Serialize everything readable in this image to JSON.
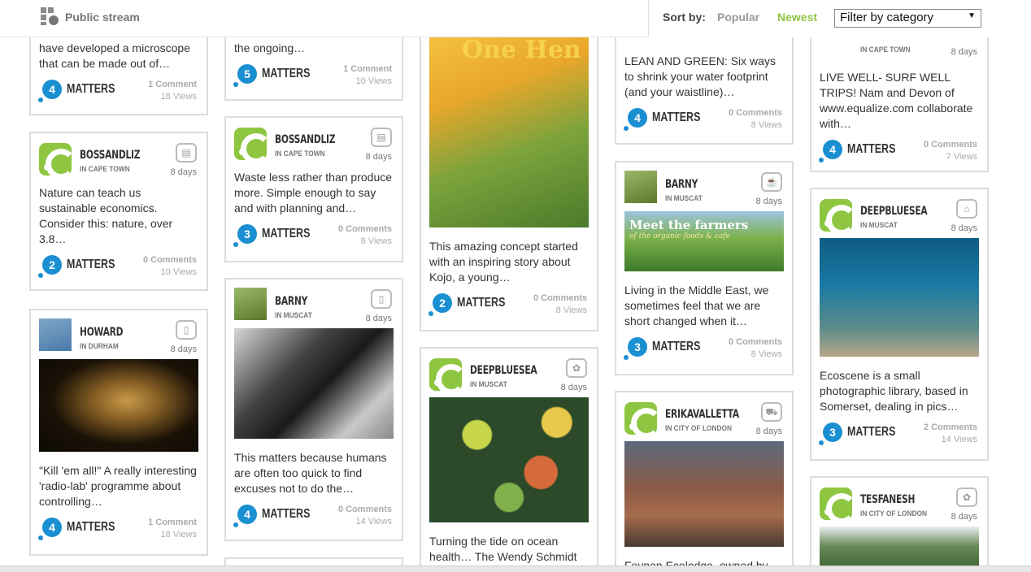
{
  "header": {
    "title": "Public stream"
  },
  "sort": {
    "label": "Sort by:",
    "popular": "Popular",
    "newest": "Newest",
    "filter": "Filter by category"
  },
  "colors": {
    "accent_green": "#8ec641",
    "badge_blue": "#1a8fd1"
  },
  "cards": {
    "c1": {
      "text": "have developed a microscope that can be made out of…",
      "matters": "4",
      "comments": "1 Comment",
      "views": "18 Views"
    },
    "c2": {
      "user": "BOSSANDLIZ",
      "loc": "IN CAPE TOWN",
      "days": "8 days",
      "text": "Nature can teach us sustainable economics. Consider this: nature, over 3.8…",
      "matters": "2",
      "comments": "0 Comments",
      "views": "10 Views",
      "icon": "chart-icon"
    },
    "c3": {
      "user": "HOWARD",
      "loc": "IN DURHAM",
      "days": "8 days",
      "text": "\"Kill 'em all!\" A really interesting 'radio-lab' programme about controlling…",
      "matters": "4",
      "comments": "1 Comment",
      "views": "18 Views",
      "icon": "phone-icon"
    },
    "c4": {
      "text": "the ongoing…",
      "matters": "5",
      "comments": "1 Comment",
      "views": "10 Views"
    },
    "c5": {
      "user": "BOSSANDLIZ",
      "loc": "IN CAPE TOWN",
      "days": "8 days",
      "text": "Waste less rather than produce more. Simple enough to say and with planning and…",
      "matters": "3",
      "comments": "0 Comments",
      "views": "8 Views",
      "icon": "chart-icon"
    },
    "c6": {
      "user": "BARNY",
      "loc": "IN MUSCAT",
      "days": "8 days",
      "text": "This matters because humans are often too quick to find excuses not to do the…",
      "matters": "4",
      "comments": "0 Comments",
      "views": "14 Views",
      "icon": "phone-icon"
    },
    "c7": {
      "text": "This amazing concept started with an inspiring story about Kojo, a young…",
      "matters": "2",
      "comments": "0 Comments",
      "views": "8 Views",
      "book_title": "One Hen"
    },
    "c8": {
      "user": "DEEPBLUESEA",
      "loc": "IN MUSCAT",
      "days": "8 days",
      "text": "Turning the tide on ocean health… The Wendy Schmidt",
      "icon": "leaf-icon"
    },
    "c9": {
      "text": "LEAN AND GREEN: Six ways to shrink your water footprint (and your waistline)…",
      "matters": "4",
      "comments": "0 Comments",
      "views": "8 Views"
    },
    "c10": {
      "user": "BARNY",
      "loc": "IN MUSCAT",
      "days": "8 days",
      "text": "Living in the Middle East, we sometimes feel that we are short changed when it…",
      "matters": "3",
      "comments": "0 Comments",
      "views": "8 Views",
      "icon": "cup-icon",
      "img_title": "Meet the farmers",
      "img_sub": "of the organic foods & cafe"
    },
    "c11": {
      "user": "ERIKAVALLETTA",
      "loc": "IN CITY OF LONDON",
      "days": "8 days",
      "text": "Feynan Ecolodge, owned by",
      "icon": "truck-icon"
    },
    "c12": {
      "text": "LIVE WELL- SURF WELL TRIPS! Nam and Devon of www.equalize.com collaborate with…",
      "matters": "4",
      "comments": "0 Comments",
      "views": "7 Views",
      "loc": "IN CAPE TOWN",
      "days": "8 days"
    },
    "c13": {
      "user": "DEEPBLUESEA",
      "loc": "IN MUSCAT",
      "days": "8 days",
      "text": "Ecoscene is a small photographic library, based in Somerset, dealing in pics…",
      "matters": "3",
      "comments": "2 Comments",
      "views": "14 Views",
      "icon": "hanger-icon"
    },
    "c14": {
      "user": "TESFANESH",
      "loc": "IN CITY OF LONDON",
      "days": "8 days",
      "icon": "leaf-icon"
    }
  },
  "matters_label": "MATTERS"
}
